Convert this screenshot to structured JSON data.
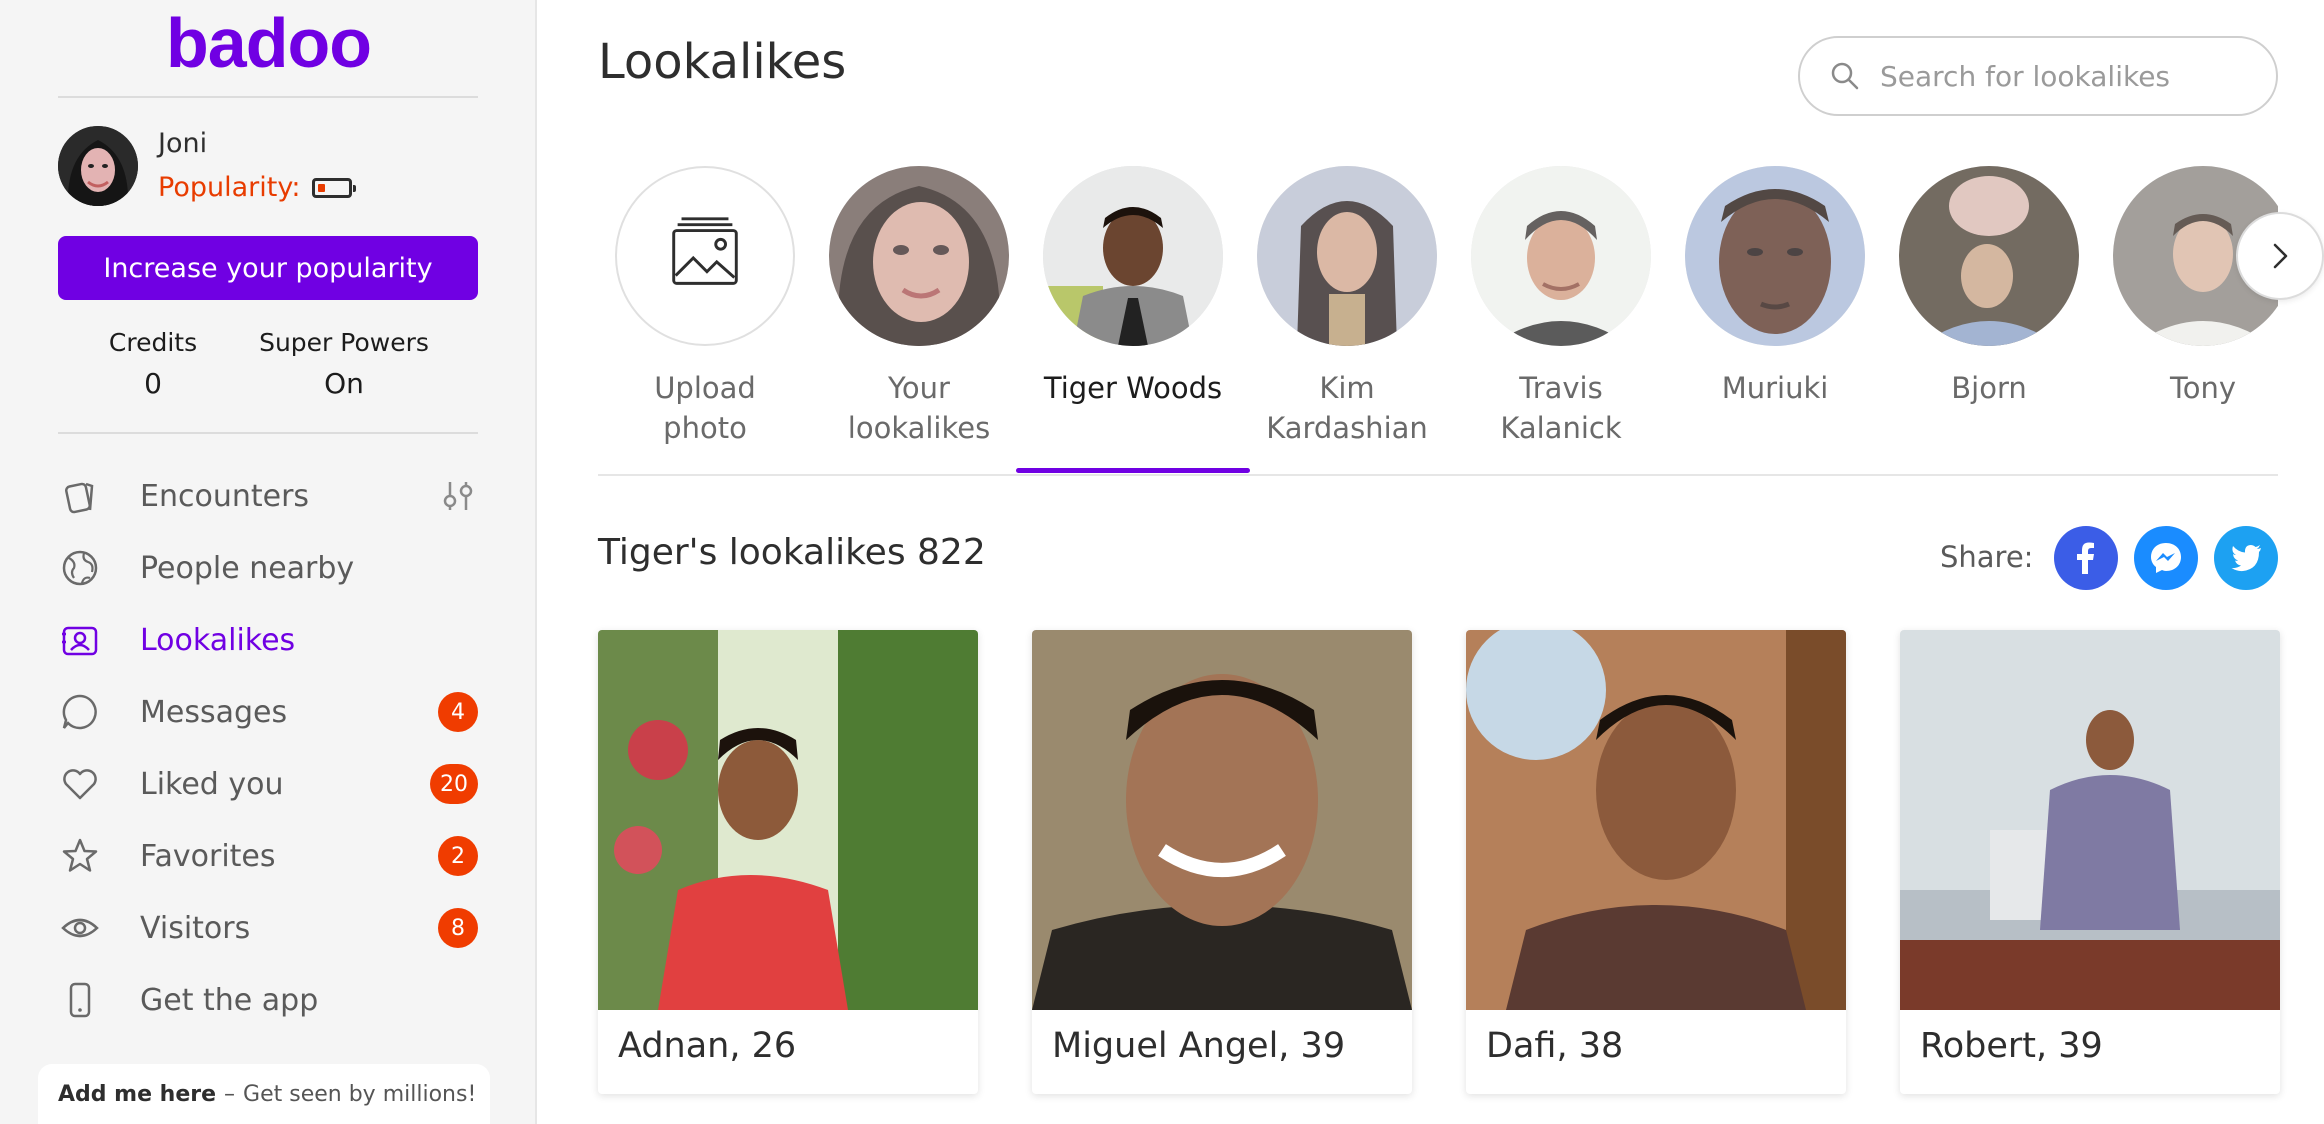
{
  "brand": {
    "logo_text": "badoo",
    "accent": "#7000e3"
  },
  "profile": {
    "name": "Joni",
    "popularity_label": "Popularity:",
    "popularity_level": 0.2
  },
  "increase_button": "Increase your popularity",
  "stats": {
    "credits_label": "Credits",
    "credits_value": "0",
    "superpowers_label": "Super Powers",
    "superpowers_value": "On"
  },
  "nav": {
    "items": [
      {
        "label": "Encounters",
        "icon": "cards-icon",
        "badge": ""
      },
      {
        "label": "People nearby",
        "icon": "globe-icon",
        "badge": ""
      },
      {
        "label": "Lookalikes",
        "icon": "lookalikes-icon",
        "badge": "",
        "active": true
      },
      {
        "label": "Messages",
        "icon": "chat-icon",
        "badge": "4"
      },
      {
        "label": "Liked you",
        "icon": "heart-icon",
        "badge": "20"
      },
      {
        "label": "Favorites",
        "icon": "star-icon",
        "badge": "2"
      },
      {
        "label": "Visitors",
        "icon": "eye-icon",
        "badge": "8"
      },
      {
        "label": "Get the app",
        "icon": "phone-icon",
        "badge": ""
      }
    ]
  },
  "add_me": {
    "bold": "Add me here",
    "sep": "–",
    "rest": "Get seen by millions!"
  },
  "page": {
    "title": "Lookalikes",
    "search_placeholder": "Search for lookalikes"
  },
  "celebrities": [
    {
      "label_line1": "Upload",
      "label_line2": "photo"
    },
    {
      "label_line1": "Your",
      "label_line2": "lookalikes"
    },
    {
      "label_line1": "Tiger Woods",
      "label_line2": "",
      "selected": true
    },
    {
      "label_line1": "Kim",
      "label_line2": "Kardashian"
    },
    {
      "label_line1": "Travis",
      "label_line2": "Kalanick"
    },
    {
      "label_line1": "Muriuki",
      "label_line2": ""
    },
    {
      "label_line1": "Bjorn",
      "label_line2": ""
    },
    {
      "label_line1": "Tony",
      "label_line2": ""
    }
  ],
  "results": {
    "title": "Tiger's lookalikes 822",
    "share_label": "Share:",
    "share_colors": {
      "facebook": "#3b5de7",
      "messenger": "#1a8cff",
      "twitter": "#1da1f2"
    }
  },
  "cards": [
    {
      "name": "Adnan, 26"
    },
    {
      "name": "Miguel Angel, 39"
    },
    {
      "name": "Dafi, 38"
    },
    {
      "name": "Robert, 39"
    }
  ]
}
